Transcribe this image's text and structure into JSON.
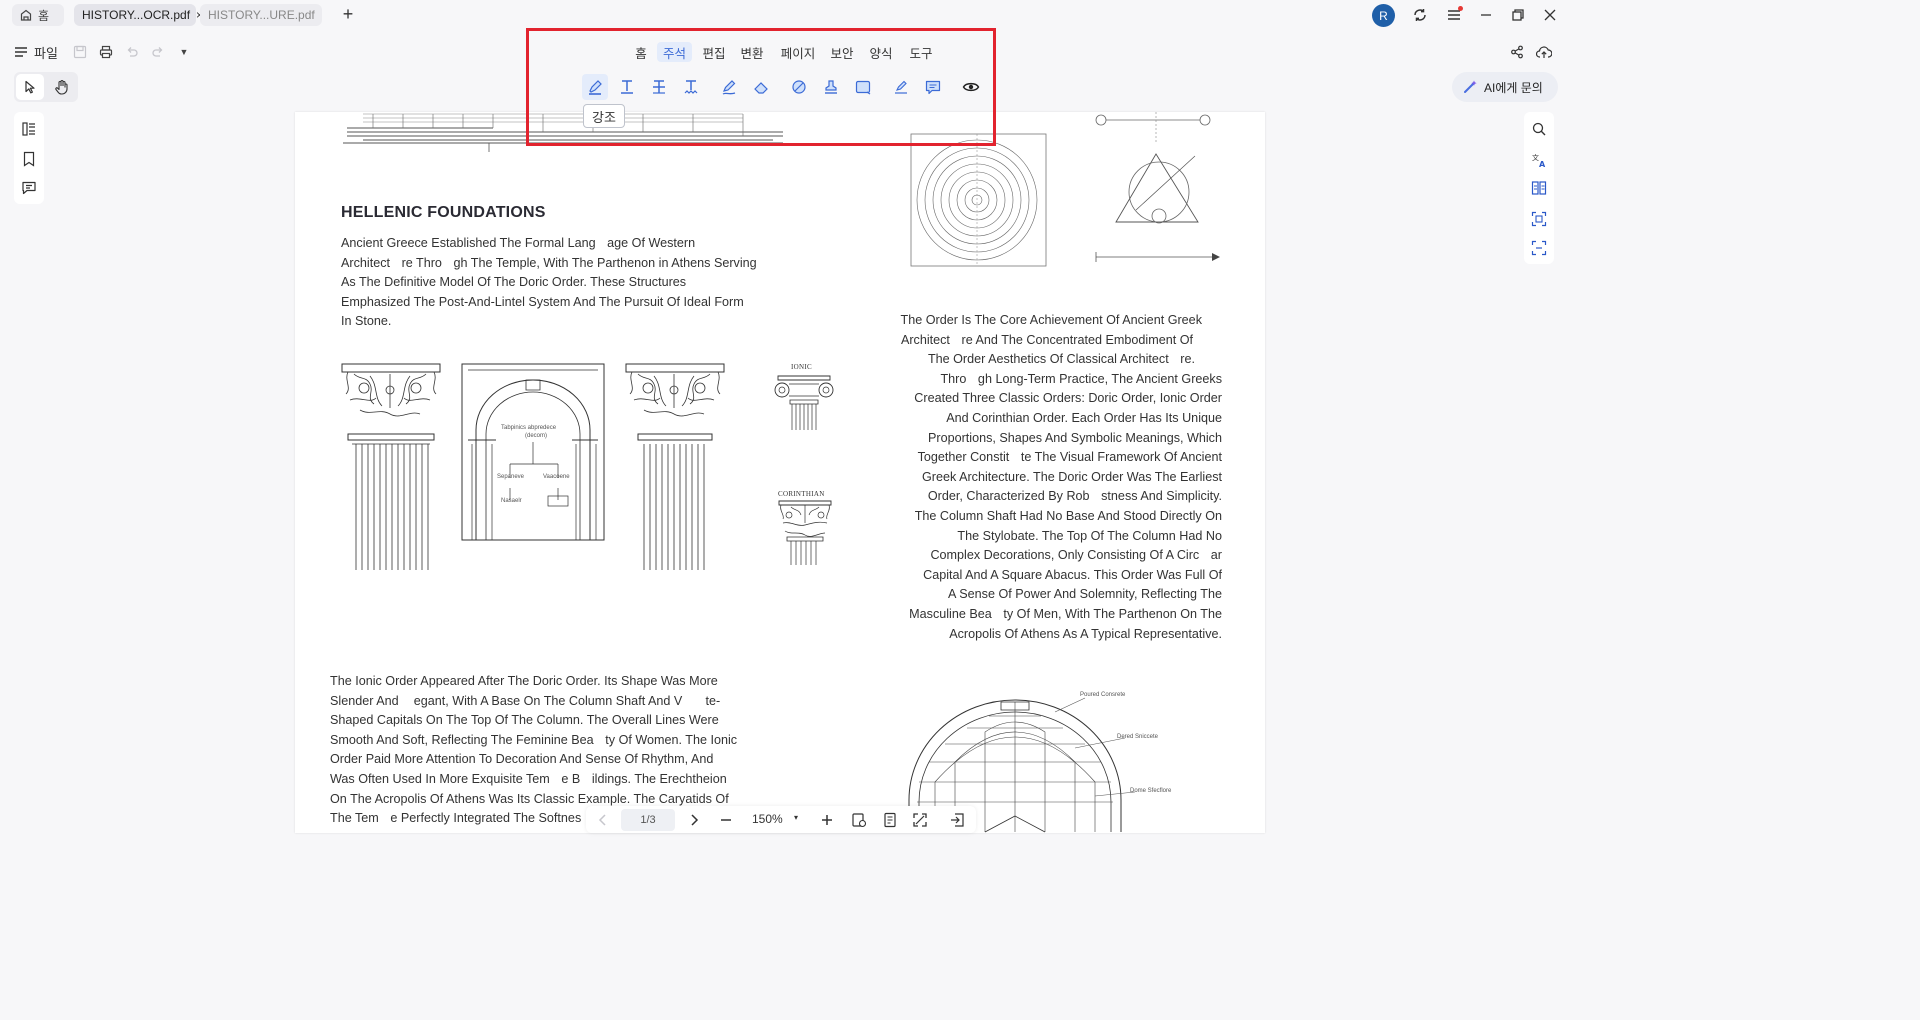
{
  "tabs": {
    "home_label": "홈",
    "tab1_label": "HISTORY...OCR.pdf",
    "tab1_close": "×",
    "tab2_label": "HISTORY...URE.pdf",
    "new_tab": "+"
  },
  "titlebar": {
    "avatar_initial": "R"
  },
  "file_menu": {
    "label": "파일"
  },
  "ribbon": {
    "menus": [
      "홈",
      "주석",
      "편집",
      "변환",
      "페이지",
      "보안",
      "양식",
      "도구"
    ],
    "active_menu": "주석",
    "tooltip": "강조"
  },
  "ai": {
    "label": "AI에게 문의"
  },
  "document": {
    "heading": "HELLENIC FOUNDATIONS",
    "intro_lines": [
      "Ancient Greece Established The Formal Langᅠage Of Western",
      "Architectᅠre Throᅠgh The Temple, With The Parthenon in Athens Serving",
      "As The Definitive Model Of The Doric Order. These Structures",
      "Emphasized The Post-And-Lintel System And The Pursuit Of Ideal Form",
      "In Stone."
    ],
    "order_lines": [
      "The Order Is The Core Achievement Of Ancient Greek",
      "Architectᅠre And The Concentrated Embodiment Of",
      "The Order Aesthetics Of Classical Architectᅠre.",
      "Throᅠgh Long-Term Practice, The Ancient Greeks",
      "Created Three Classic Orders: Doric Order, Ionic Order",
      "And Corinthian Order. Each Order Has Its Unique",
      "Proportions, Shapes And Symbolic Meanings, Which",
      "Together Constitᅠte The Visual Framework Of Ancient",
      "Greek Architecture. The Doric Order Was The Earliest",
      "Order, Characterized By Robᅠstness And Simplicity.",
      "The Column Shaft Had No Base And Stood Directly On",
      "The Stylobate. The Top Of The Column Had No",
      "Complex Decorations, Only Consisting Of A Circᅠar",
      "Capital And A Square Abacus. This Order Was Full Of",
      "A Sense Of Power And Solemnity, Reflecting The",
      "Masculine Beaᅠty Of Men, With The Parthenon On The",
      "Acropolis Of Athens As A Typical Representative."
    ],
    "ionic_lines": [
      "The Ionic Order Appeared After The Doric Order. Its Shape Was More",
      "Slender And ᅠegant, With A Base On The Column Shaft And Vᅠᅠte-",
      "Shaped Capitals On The Top Of The Column. The Overall Lines Were",
      "Smooth And Soft, Reflecting The Feminine Beaᅠty Of Women. The Ionic",
      "Order Paid More Attention To Decoration And Sense Of Rhythm, And",
      "Was Often Used In More Exquisite Temᅠe Bᅠildings. The Erechtheion",
      "On The Acropolis Of Athens Was Its Classic Example. The Caryatids Of",
      "The Temᅠe Perfectly Integrated The Softnes"
    ],
    "caption_ionic": "IONIC",
    "caption_corinthian": "CORINTHIAN",
    "dome_labels": [
      "Poured Consrete",
      "Dered Sniccete",
      "Dome Sfecflore"
    ],
    "arch_chart_labels": [
      "Tabpinics abpredece",
      "(decom)",
      "Sepaneve",
      "Vaacoene",
      "Nasaelr"
    ]
  },
  "pagenav": {
    "page": "1/3",
    "zoom": "150%",
    "zoom_caret": "▾"
  },
  "colors": {
    "ribbon_highlight": "#e2232e",
    "accent": "#3c6bd6",
    "avatar": "#1f5fa8"
  }
}
